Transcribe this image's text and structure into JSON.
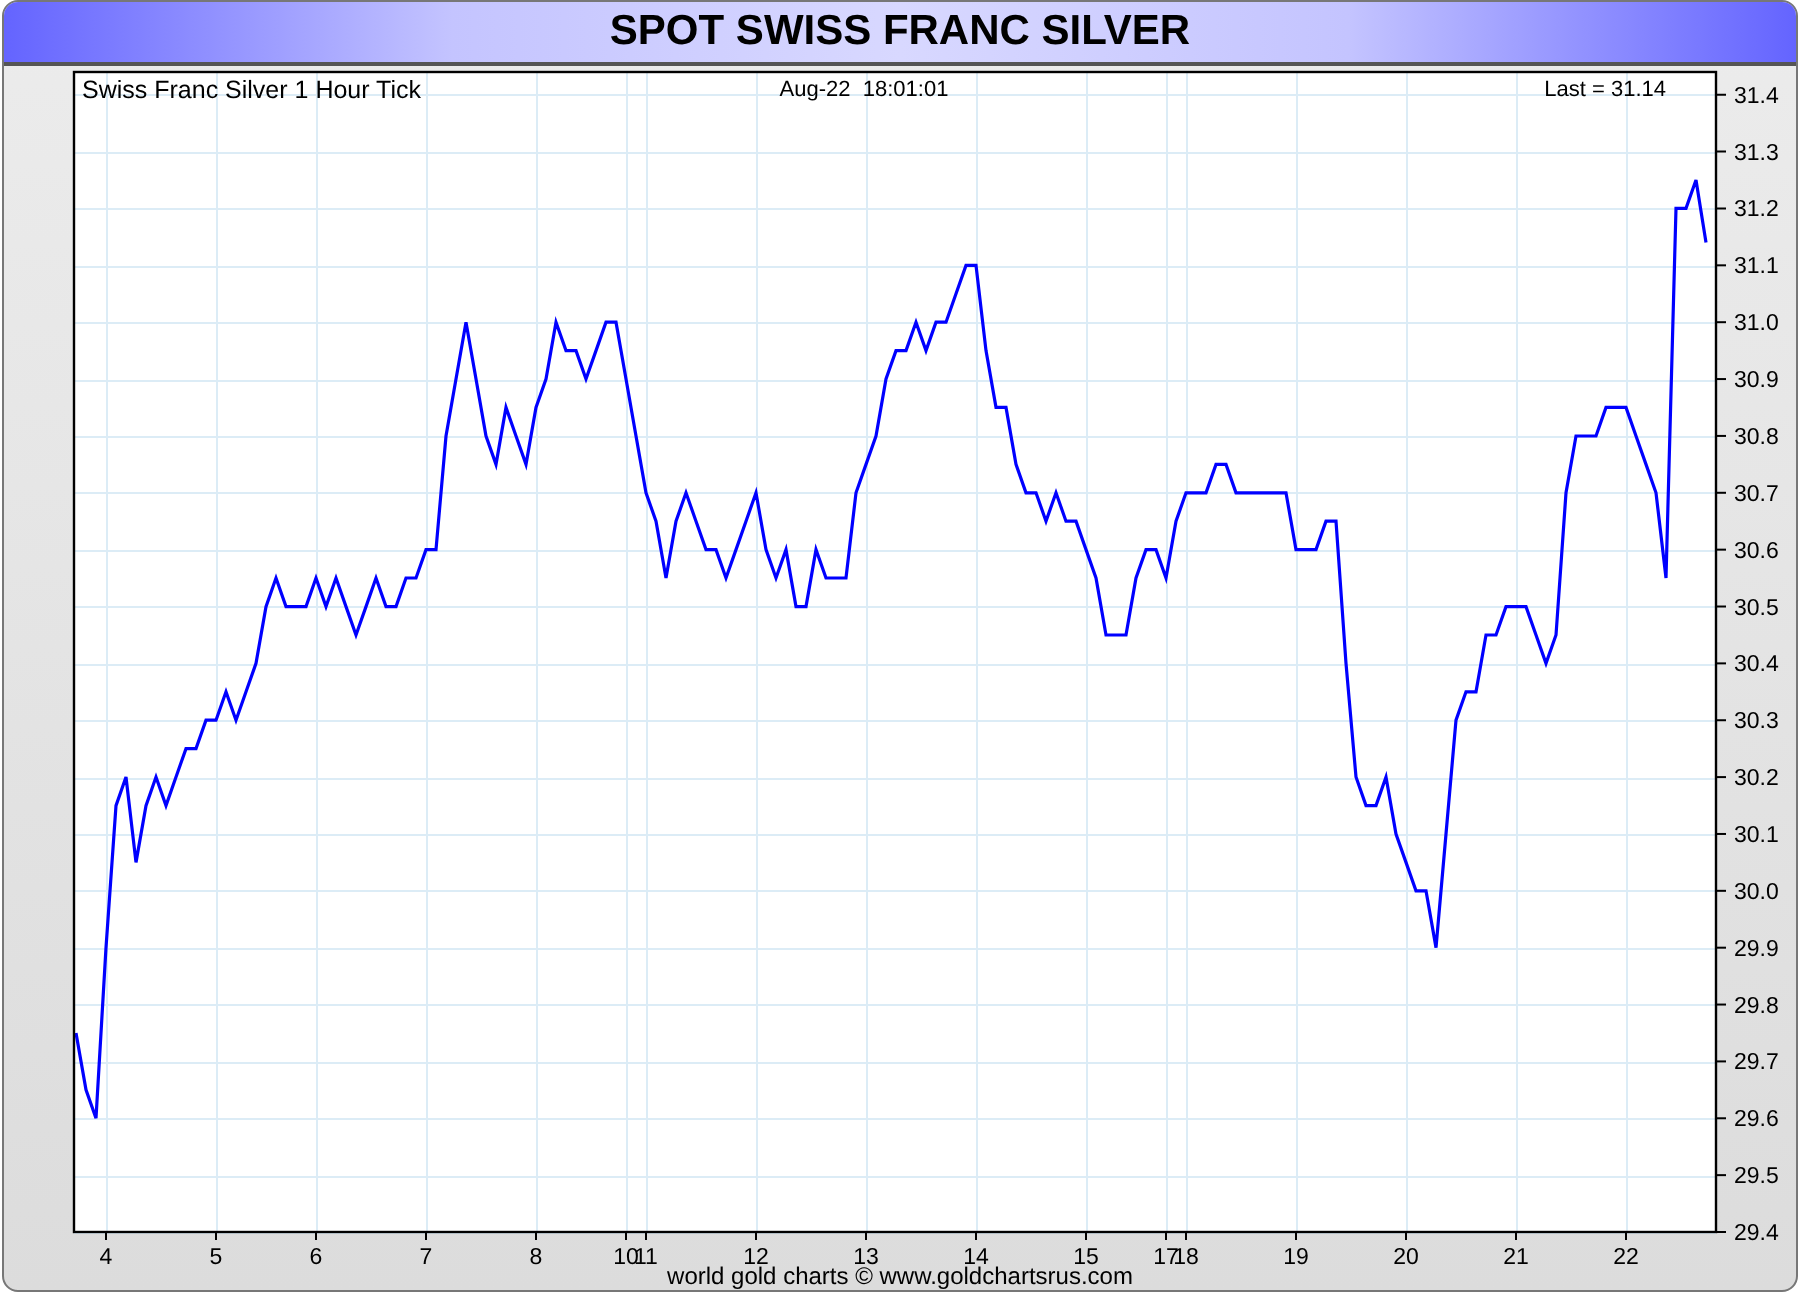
{
  "title": "SPOT SWISS FRANC SILVER",
  "chart": {
    "label": "Swiss Franc Silver 1 Hour Tick",
    "timestamp": "Aug-22  18:01:01",
    "last": "Last = 31.14",
    "chart_data": {
      "type": "line",
      "categories": [
        null,
        null,
        null,
        "4",
        null,
        null,
        null,
        null,
        null,
        null,
        null,
        null,
        null,
        null,
        "5",
        null,
        null,
        null,
        null,
        null,
        null,
        null,
        null,
        null,
        "6",
        null,
        null,
        null,
        null,
        null,
        null,
        null,
        null,
        null,
        null,
        "7",
        null,
        null,
        null,
        null,
        null,
        null,
        null,
        null,
        null,
        null,
        "8",
        null,
        null,
        null,
        null,
        null,
        null,
        null,
        null,
        "10",
        null,
        "11",
        null,
        null,
        null,
        null,
        null,
        null,
        null,
        null,
        null,
        null,
        "12",
        null,
        null,
        null,
        null,
        null,
        null,
        null,
        null,
        null,
        null,
        "13",
        null,
        null,
        null,
        null,
        null,
        null,
        null,
        null,
        null,
        null,
        "14",
        null,
        null,
        null,
        null,
        null,
        null,
        null,
        null,
        null,
        null,
        "15",
        null,
        null,
        null,
        null,
        null,
        null,
        null,
        "17",
        null,
        "18",
        null,
        null,
        null,
        null,
        null,
        null,
        null,
        null,
        null,
        null,
        "19",
        null,
        null,
        null,
        null,
        null,
        null,
        null,
        null,
        null,
        null,
        "20",
        null,
        null,
        null,
        null,
        null,
        null,
        null,
        null,
        null,
        null,
        "21",
        null,
        null,
        null,
        null,
        null,
        null,
        null,
        null,
        null,
        null,
        "22",
        null,
        null,
        null,
        null,
        null,
        null,
        null,
        null
      ],
      "series": [
        {
          "color": "#0000ff",
          "values": [
            29.75,
            29.65,
            29.6,
            29.9,
            30.15,
            30.2,
            30.05,
            30.15,
            30.2,
            30.15,
            30.2,
            30.25,
            30.25,
            30.3,
            30.3,
            30.35,
            30.3,
            30.35,
            30.4,
            30.5,
            30.55,
            30.5,
            30.5,
            30.5,
            30.55,
            30.5,
            30.55,
            30.5,
            30.45,
            30.5,
            30.55,
            30.5,
            30.5,
            30.55,
            30.55,
            30.6,
            30.6,
            30.8,
            30.9,
            31.0,
            30.9,
            30.8,
            30.75,
            30.85,
            30.8,
            30.75,
            30.85,
            30.9,
            31.0,
            30.95,
            30.95,
            30.9,
            30.95,
            31.0,
            31.0,
            30.9,
            30.8,
            30.7,
            30.65,
            30.55,
            30.65,
            30.7,
            30.65,
            30.6,
            30.6,
            30.55,
            30.6,
            30.65,
            30.7,
            30.6,
            30.55,
            30.6,
            30.5,
            30.5,
            30.6,
            30.55,
            30.55,
            30.55,
            30.7,
            30.75,
            30.8,
            30.9,
            30.95,
            30.95,
            31.0,
            30.95,
            31.0,
            31.0,
            31.05,
            31.1,
            31.1,
            30.95,
            30.85,
            30.85,
            30.75,
            30.7,
            30.7,
            30.65,
            30.7,
            30.65,
            30.65,
            30.6,
            30.55,
            30.45,
            30.45,
            30.45,
            30.55,
            30.6,
            30.6,
            30.55,
            30.65,
            30.7,
            30.7,
            30.7,
            30.75,
            30.75,
            30.7,
            30.7,
            30.7,
            30.7,
            30.7,
            30.7,
            30.6,
            30.6,
            30.6,
            30.65,
            30.65,
            30.4,
            30.2,
            30.15,
            30.15,
            30.2,
            30.1,
            30.05,
            30.0,
            30.0,
            29.9,
            30.1,
            30.3,
            30.35,
            30.35,
            30.45,
            30.45,
            30.5,
            30.5,
            30.5,
            30.45,
            30.4,
            30.45,
            30.7,
            30.8,
            30.8,
            30.8,
            30.85,
            30.85,
            30.85,
            30.8,
            30.75,
            30.7,
            30.55,
            31.2,
            31.2,
            31.25,
            31.14
          ]
        }
      ],
      "ylim": [
        29.4,
        31.44
      ],
      "grid": true,
      "yticks": [
        {
          "value": 29.4,
          "label": "29.4"
        },
        {
          "value": 29.5,
          "label": "29.5"
        },
        {
          "value": 29.6,
          "label": "29.6"
        },
        {
          "value": 29.7,
          "label": "29.7"
        },
        {
          "value": 29.8,
          "label": "29.8"
        },
        {
          "value": 29.9,
          "label": "29.9"
        },
        {
          "value": 30,
          "label": "30.0"
        },
        {
          "value": 30.1,
          "label": "30.1"
        },
        {
          "value": 30.2,
          "label": "30.2"
        },
        {
          "value": 30.3,
          "label": "30.3"
        },
        {
          "value": 30.4,
          "label": "30.4"
        },
        {
          "value": 30.5,
          "label": "30.5"
        },
        {
          "value": 30.6,
          "label": "30.6"
        },
        {
          "value": 30.7,
          "label": "30.7"
        },
        {
          "value": 30.8,
          "label": "30.8"
        },
        {
          "value": 30.9,
          "label": "30.9"
        },
        {
          "value": 31,
          "label": "31.0"
        },
        {
          "value": 31.1,
          "label": "31.1"
        },
        {
          "value": 31.2,
          "label": "31.2"
        },
        {
          "value": 31.3,
          "label": "31.3"
        },
        {
          "value": 31.4,
          "label": "31.4"
        }
      ]
    }
  },
  "footer": "world gold charts © www.goldchartsrus.com"
}
